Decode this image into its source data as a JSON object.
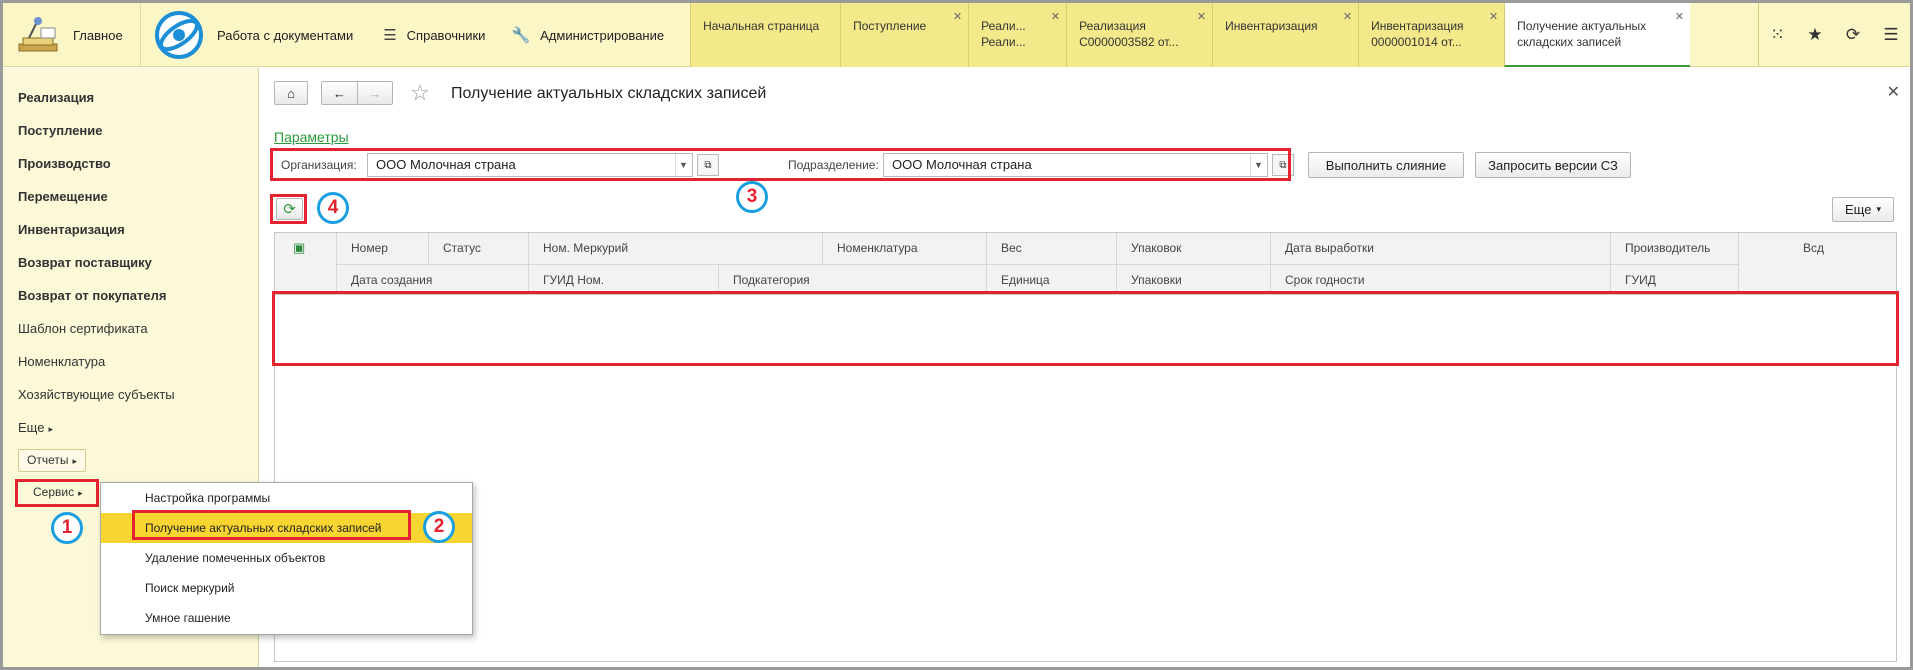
{
  "topbar": {
    "main_label": "Главное",
    "docs_label": "Работа с документами",
    "refs_label": "Справочники",
    "admin_label": "Администрирование",
    "tabs": [
      {
        "line1": "Начальная страница",
        "line2": ""
      },
      {
        "line1": "Поступление",
        "line2": ""
      },
      {
        "line1": "Реали...",
        "line2": "Реали..."
      },
      {
        "line1": "Реализация",
        "line2": "С0000003582 от..."
      },
      {
        "line1": "Инвентаризация",
        "line2": ""
      },
      {
        "line1": "Инвентаризация",
        "line2": "0000001014 от..."
      },
      {
        "line1": "Получение актуальных",
        "line2": "складских записей"
      }
    ]
  },
  "sidebar": {
    "items": [
      "Реализация",
      "Поступление",
      "Производство",
      "Перемещение",
      "Инвентаризация",
      "Возврат поставщику",
      "Возврат от покупателя",
      "Шаблон сертификата",
      "Номенклатура",
      "Хозяйствующие субъекты",
      "Еще"
    ],
    "reports_label": "Отчеты",
    "service_label": "Сервис"
  },
  "menu": {
    "items": [
      "Настройка программы",
      "Получение актуальных складских записей",
      "Удаление помеченных объектов",
      "Поиск меркурий",
      "Умное гашение"
    ]
  },
  "form": {
    "title": "Получение актуальных складских записей",
    "params_link": "Параметры",
    "org_label": "Организация:",
    "org_value": "ООО Молочная страна",
    "dept_label": "Подразделение:",
    "dept_value": "ООО Молочная страна",
    "merge_button": "Выполнить слияние",
    "request_button": "Запросить версии СЗ",
    "more_button": "Еще"
  },
  "table": {
    "row1": [
      "Номер",
      "Статус",
      "Ном. Меркурий",
      "Номенклатура",
      "Вес",
      "Упаковок",
      "Дата выработки",
      "Производитель",
      "Всд"
    ],
    "row2": [
      "Дата создания",
      "ГУИД Ном.",
      "Подкатегория",
      "Единица",
      "Упаковки",
      "Срок годности",
      "ГУИД"
    ]
  },
  "callouts": [
    "1",
    "2",
    "3",
    "4"
  ],
  "colors": {
    "highlight": "#e3232f",
    "callout_ring": "#1a9fe0",
    "menu_highlight": "#f8d531",
    "topbar_bg": "#fbf6c6",
    "link": "#2a9a3b"
  },
  "icons": [
    "app-logo-icon",
    "docs-logo-icon",
    "list-icon",
    "wrench-icon",
    "apps-grid-icon",
    "star-icon",
    "history-icon",
    "menu-icon",
    "home-icon",
    "back-arrow-icon",
    "forward-arrow-icon",
    "favorite-star-icon",
    "refresh-icon",
    "copy-icon"
  ]
}
